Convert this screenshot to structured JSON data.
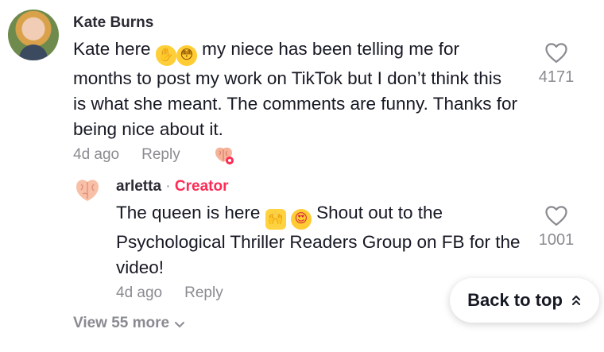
{
  "comment": {
    "author": "Kate Burns",
    "text_before_emoji": "Kate here ",
    "emoji_1": "waving-hand",
    "emoji_2": "flushed-face",
    "text_after_emoji": " my niece has been telling me for months to post my work on TikTok but I don’t think this is what she meant. The comments are funny. Thanks for being nice about it.",
    "time": "4d ago",
    "reply_label": "Reply",
    "like_count": "4171"
  },
  "reply": {
    "author": "arletta",
    "separator": " · ",
    "badge": "Creator",
    "text_1": "The queen is here ",
    "emoji_1": "raising-hands",
    "emoji_2": "heart-eyes",
    "text_2": " Shout out to the Psychological Thriller Readers Group on FB for the video!",
    "time": "4d ago",
    "reply_label": "Reply",
    "like_count": "1001"
  },
  "view_more": "View 55 more",
  "back_to_top": "Back to top",
  "colors": {
    "creator": "#fe2c55",
    "muted": "#8a8b91",
    "text": "#161823"
  }
}
